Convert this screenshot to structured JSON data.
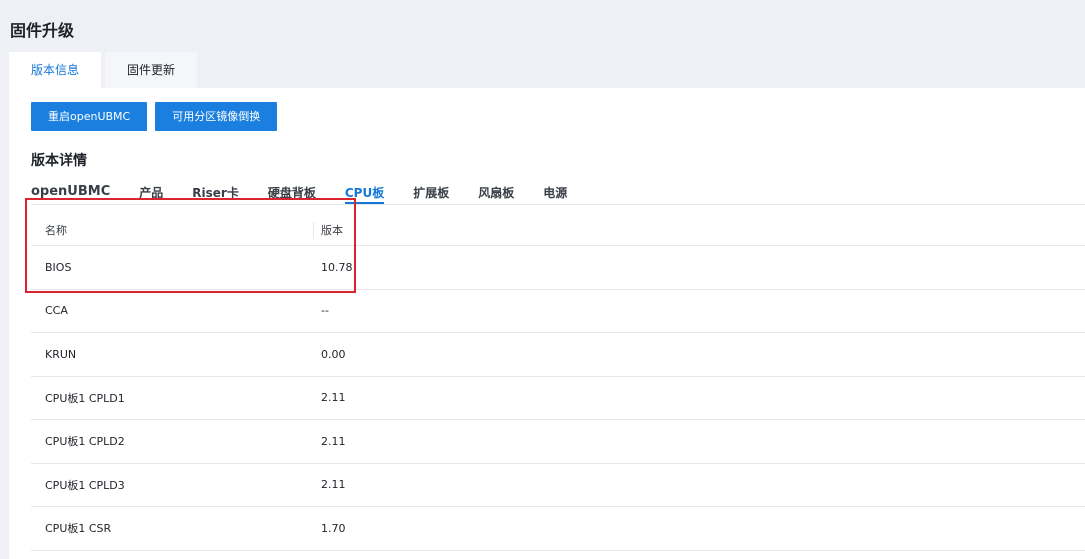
{
  "page": {
    "title": "固件升级"
  },
  "top_tabs": [
    {
      "label": "版本信息",
      "active": true
    },
    {
      "label": "固件更新",
      "active": false
    }
  ],
  "buttons": {
    "restart": "重启openUBMC",
    "switch_image": "可用分区镜像倒换"
  },
  "section": {
    "title": "版本详情"
  },
  "sub_tabs": [
    {
      "label": "openUBMC"
    },
    {
      "label": "产品"
    },
    {
      "label": "Riser卡"
    },
    {
      "label": "硬盘背板"
    },
    {
      "label": "CPU板"
    },
    {
      "label": "扩展板"
    },
    {
      "label": "风扇板"
    },
    {
      "label": "电源"
    }
  ],
  "active_sub_tab": "CPU板",
  "table": {
    "headers": {
      "name": "名称",
      "version": "版本"
    },
    "rows": [
      {
        "name": "BIOS",
        "version": "10.78"
      },
      {
        "name": "CCA",
        "version": "--"
      },
      {
        "name": "KRUN",
        "version": "0.00"
      },
      {
        "name": "CPU板1 CPLD1",
        "version": "2.11"
      },
      {
        "name": "CPU板1 CPLD2",
        "version": "2.11"
      },
      {
        "name": "CPU板1 CPLD3",
        "version": "2.11"
      },
      {
        "name": "CPU板1 CSR",
        "version": "1.70"
      }
    ]
  },
  "colors": {
    "accent": "#1677d9",
    "button": "#1b7fe0",
    "highlight": "#d9252f",
    "background": "#eef0f5"
  }
}
